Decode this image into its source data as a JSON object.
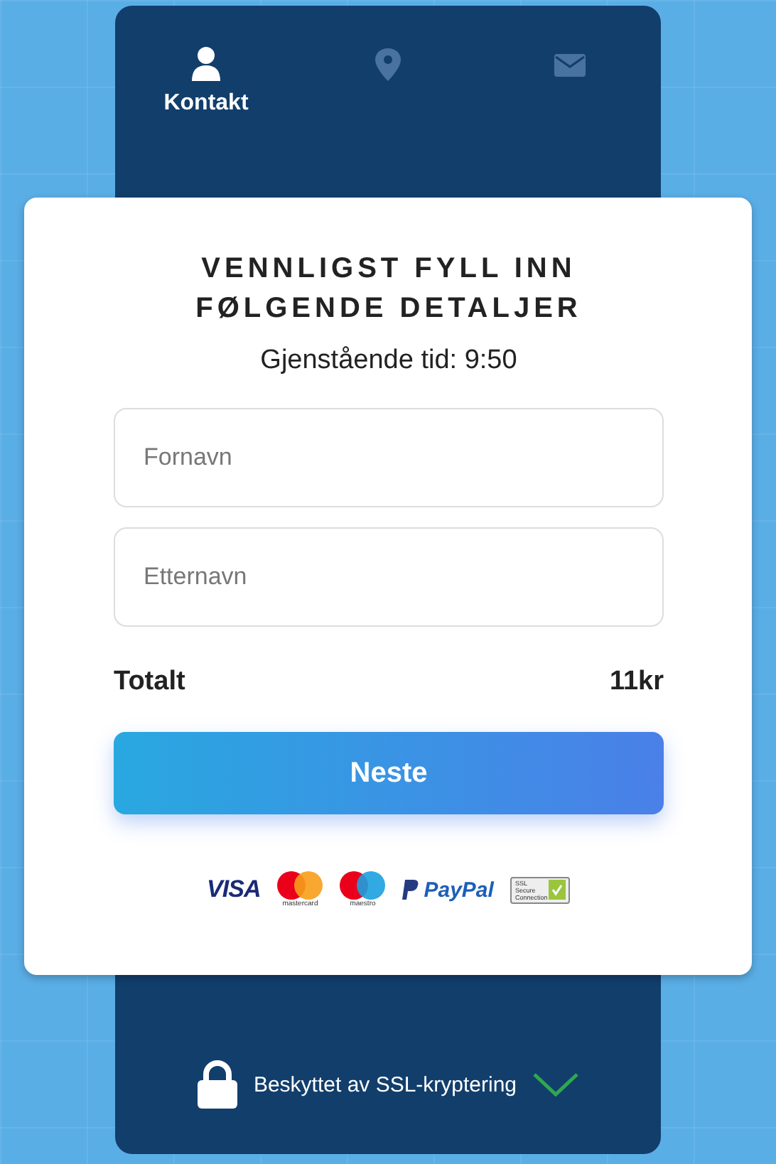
{
  "tabs": [
    {
      "kind": "person",
      "label": "Kontakt",
      "selected": true
    },
    {
      "kind": "pin",
      "selected": false
    },
    {
      "kind": "mail",
      "selected": false
    }
  ],
  "form": {
    "title": "VENNLIGST FYLL INN FØLGENDE DETALJER",
    "timer": "Gjenstående tid: 9:50",
    "fields": [
      {
        "placeholder": "Fornavn"
      },
      {
        "placeholder": "Etternavn"
      }
    ],
    "total_label": "Totalt",
    "total_value": "11kr",
    "next_button": "Neste",
    "payment_logos": [
      {
        "kind": "visa",
        "text": "VISA"
      },
      {
        "kind": "mastercard",
        "text": "mastercard"
      },
      {
        "kind": "maestro",
        "text": "maestro"
      },
      {
        "kind": "paypal",
        "text": "PayPal"
      },
      {
        "kind": "ssl",
        "text": "SSL Secure Connection"
      }
    ]
  },
  "footer": {
    "text": "Beskyttet av SSL-kryptering"
  }
}
